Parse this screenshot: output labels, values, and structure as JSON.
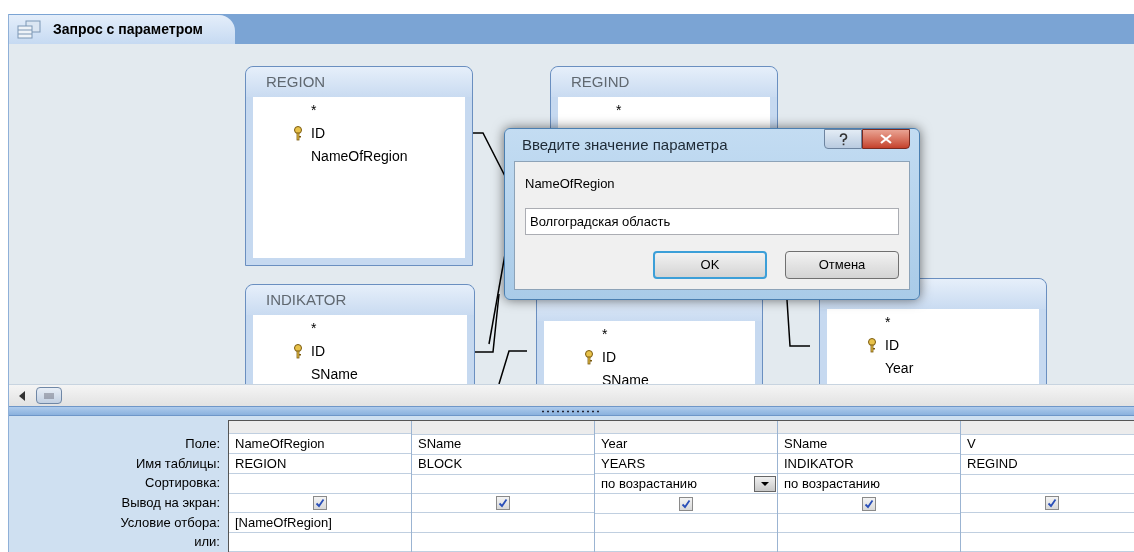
{
  "document_tab": {
    "title": "Запрос с параметром",
    "selected": true
  },
  "tables": [
    {
      "title": "REGION",
      "fields": [
        {
          "name": "*",
          "key": false
        },
        {
          "name": "ID",
          "key": true
        },
        {
          "name": "NameOfRegion",
          "key": false
        }
      ]
    },
    {
      "title": "REGIND",
      "fields": [
        {
          "name": "*",
          "key": false
        }
      ]
    },
    {
      "title": "INDIKATOR",
      "fields": [
        {
          "name": "*",
          "key": false
        },
        {
          "name": "ID",
          "key": true
        },
        {
          "name": "SName",
          "key": false
        }
      ]
    },
    {
      "fields": [
        {
          "name": "*",
          "key": false
        },
        {
          "name": "ID",
          "key": true
        },
        {
          "name": "SName",
          "key": false
        }
      ]
    },
    {
      "fields": [
        {
          "name": "*",
          "key": false
        },
        {
          "name": "ID",
          "key": true
        },
        {
          "name": "Year",
          "key": false
        }
      ]
    }
  ],
  "dialog": {
    "title": "Введите значение параметра",
    "prompt": "NameOfRegion",
    "value": "Волгоградская область",
    "buttons": [
      {
        "label": "OK",
        "default": true
      },
      {
        "label": "Отмена",
        "default": false
      }
    ]
  },
  "grid": {
    "row_labels": [
      "Поле:",
      "Имя таблицы:",
      "Сортировка:",
      "Вывод на экран:",
      "Условие отбора:",
      "или:"
    ],
    "columns": [
      {
        "field": "NameOfRegion",
        "table": "REGION",
        "sort_dropdown": false,
        "show": true,
        "criteria": "[NameOfRegion]"
      },
      {
        "field": "SName",
        "table": "BLOCK",
        "sort_dropdown": false,
        "show": true
      },
      {
        "field": "Year",
        "table": "YEARS",
        "sort": "по возрастанию",
        "sort_dropdown": true,
        "show": true
      },
      {
        "field": "SName",
        "table": "INDIKATOR",
        "sort": "по возрастанию",
        "sort_dropdown": false,
        "show": true
      },
      {
        "field": "V",
        "table": "REGIND",
        "sort_dropdown": false,
        "show": true
      }
    ]
  }
}
